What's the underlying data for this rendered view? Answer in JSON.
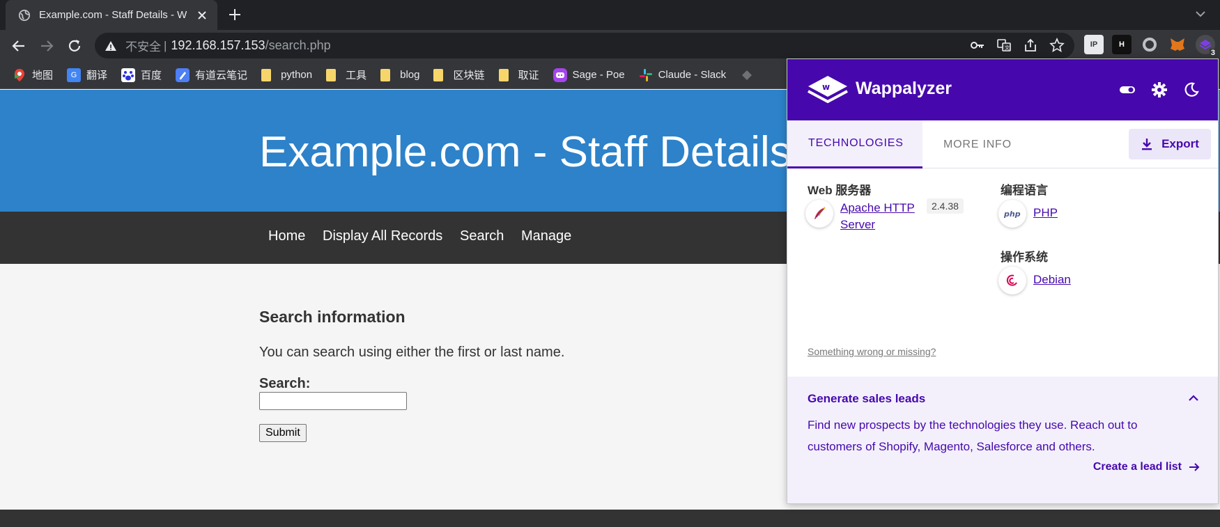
{
  "browser": {
    "tab_title": "Example.com - Staff Details - W",
    "address": {
      "security_label": "不安全",
      "separator": "|",
      "host": "192.168.157.153",
      "path": "/search.php"
    },
    "extension_badge": "3",
    "bookmarks": [
      {
        "label": "地图",
        "icon": "maps-icon"
      },
      {
        "label": "翻译",
        "icon": "translate-icon"
      },
      {
        "label": "百度",
        "icon": "baidu-icon"
      },
      {
        "label": "有道云笔记",
        "icon": "youdao-note-icon"
      },
      {
        "label": "python",
        "icon": "folder-icon"
      },
      {
        "label": "工具",
        "icon": "folder-icon"
      },
      {
        "label": "blog",
        "icon": "folder-icon"
      },
      {
        "label": "区块链",
        "icon": "folder-icon"
      },
      {
        "label": "取证",
        "icon": "folder-icon"
      },
      {
        "label": "Sage - Poe",
        "icon": "poe-icon"
      },
      {
        "label": "Claude - Slack",
        "icon": "slack-icon"
      }
    ]
  },
  "page": {
    "title": "Example.com - Staff Details",
    "nav": [
      "Home",
      "Display All Records",
      "Search",
      "Manage"
    ],
    "heading": "Search information",
    "intro": "You can search using either the first or last name.",
    "search_label": "Search:",
    "search_value": "",
    "submit_label": "Submit"
  },
  "wappalyzer": {
    "brand": "Wappalyzer",
    "tabs": [
      "TECHNOLOGIES",
      "MORE INFO"
    ],
    "export_label": "Export",
    "categories": [
      {
        "name": "Web 服务器",
        "tech": "Apache HTTP Server",
        "tech_line1": "Apache HTTP",
        "tech_line2": "Server",
        "version": "2.4.38",
        "icon": "apache-feather-icon"
      },
      {
        "name": "编程语言",
        "tech": "PHP",
        "icon": "php-icon"
      },
      {
        "name": "操作系统",
        "tech": "Debian",
        "icon": "debian-icon"
      }
    ],
    "wrong_link": "Something wrong or missing?",
    "leads": {
      "title": "Generate sales leads",
      "text": "Find new prospects by the technologies they use. Reach out to customers of Shopify, Magento, Salesforce and others.",
      "cta": "Create a lead list"
    },
    "colors": {
      "brand": "#4608ad",
      "header_bg": "#2d82c9",
      "nav_bg": "#333333"
    }
  }
}
